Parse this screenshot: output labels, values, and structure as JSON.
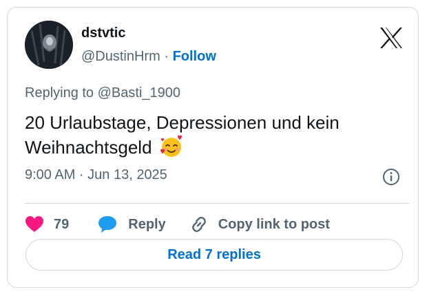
{
  "author": {
    "name": "dstvtic",
    "handle": "@DustinHrm",
    "separator": "·",
    "follow_label": "Follow"
  },
  "tweet": {
    "replying_to": "Replying to @Basti_1900",
    "text": "20 Urlaubstage, Depressionen und kein Weihnachtsgeld",
    "emoji": "smiling-face-with-hearts",
    "timestamp": "9:00 AM · Jun 13, 2025"
  },
  "actions": {
    "like_count": "79",
    "reply_label": "Reply",
    "copy_label": "Copy link to post"
  },
  "read_replies_label": "Read 7 replies",
  "colors": {
    "link": "#006fd6",
    "like": "#f91880",
    "reply": "#1d9bf0",
    "secondary_text": "#536471",
    "border": "#cfd9de"
  },
  "icons": [
    "x-logo-icon",
    "info-icon",
    "heart-icon",
    "reply-bubble-icon",
    "link-icon"
  ]
}
